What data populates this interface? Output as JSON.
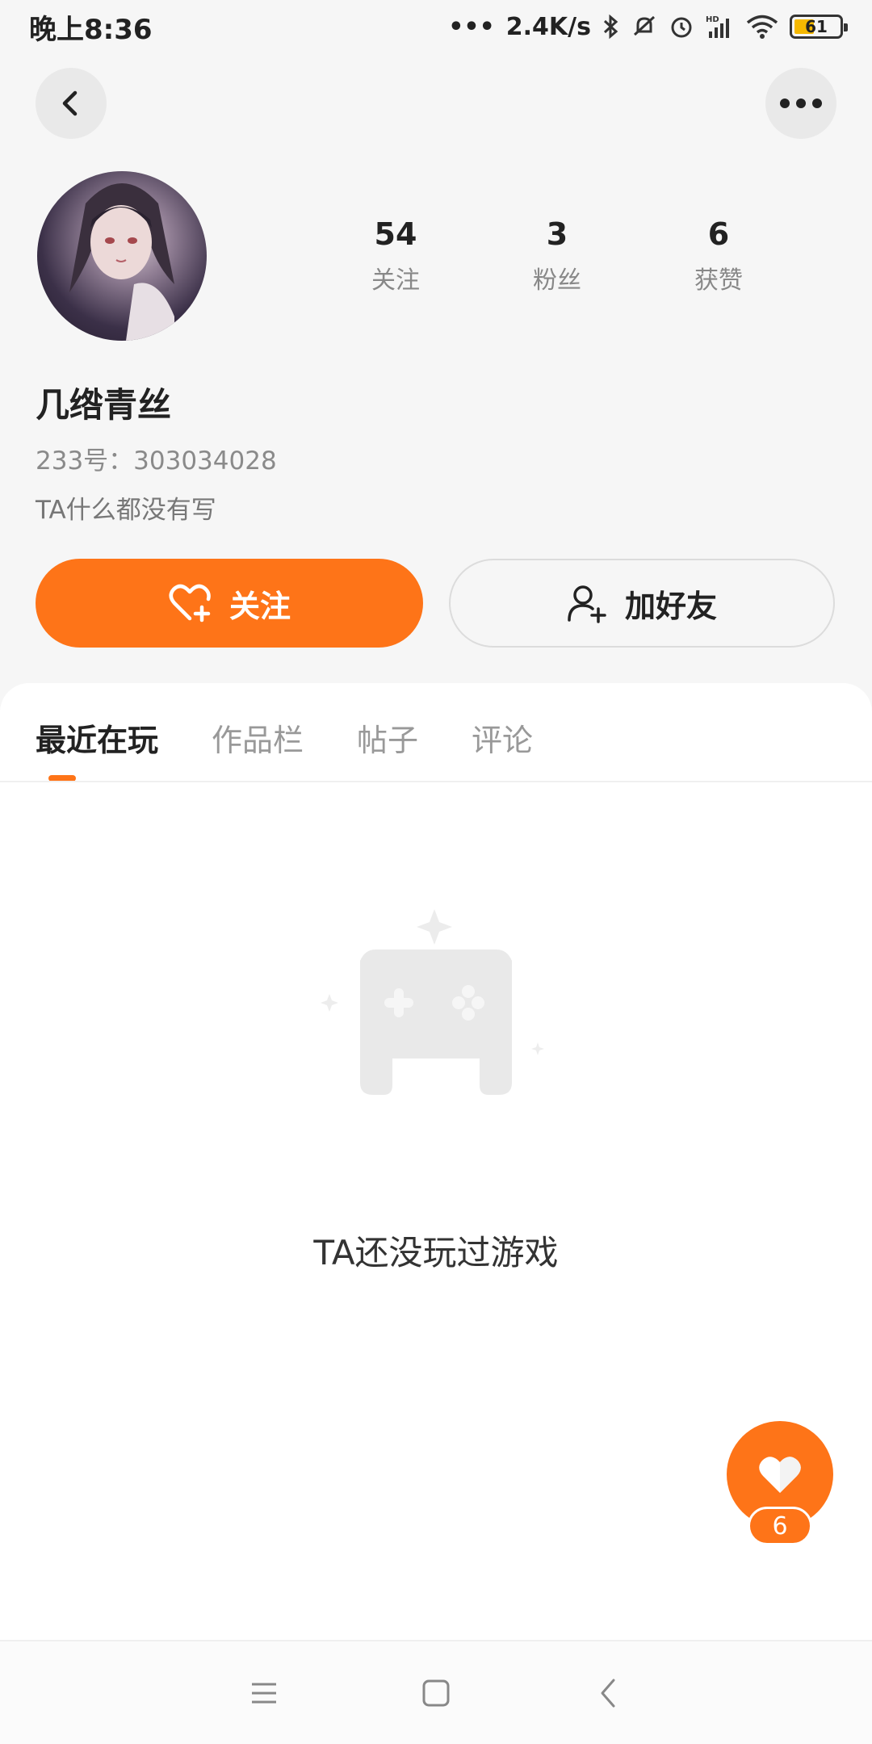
{
  "status_bar": {
    "time": "晚上8:36",
    "network_speed": "2.4K/s",
    "battery": "61",
    "signal_label": "HD"
  },
  "header": {
    "back_icon": "chevron-left-icon",
    "more_icon": "more-dots-icon"
  },
  "profile": {
    "username": "几绺青丝",
    "uid": "233号：303034028",
    "bio": "TA什么都没有写",
    "stats": [
      {
        "value": "54",
        "label": "关注"
      },
      {
        "value": "3",
        "label": "粉丝"
      },
      {
        "value": "6",
        "label": "获赞"
      }
    ]
  },
  "actions": {
    "follow_label": "关注",
    "add_friend_label": "加好友"
  },
  "tabs": [
    "最近在玩",
    "作品栏",
    "帖子",
    "评论"
  ],
  "active_tab": "最近在玩",
  "empty_state": {
    "text": "TA还没玩过游戏"
  },
  "like_fab": {
    "count": "6"
  },
  "colors": {
    "accent": "#fe7418",
    "background": "#f6f6f6"
  }
}
